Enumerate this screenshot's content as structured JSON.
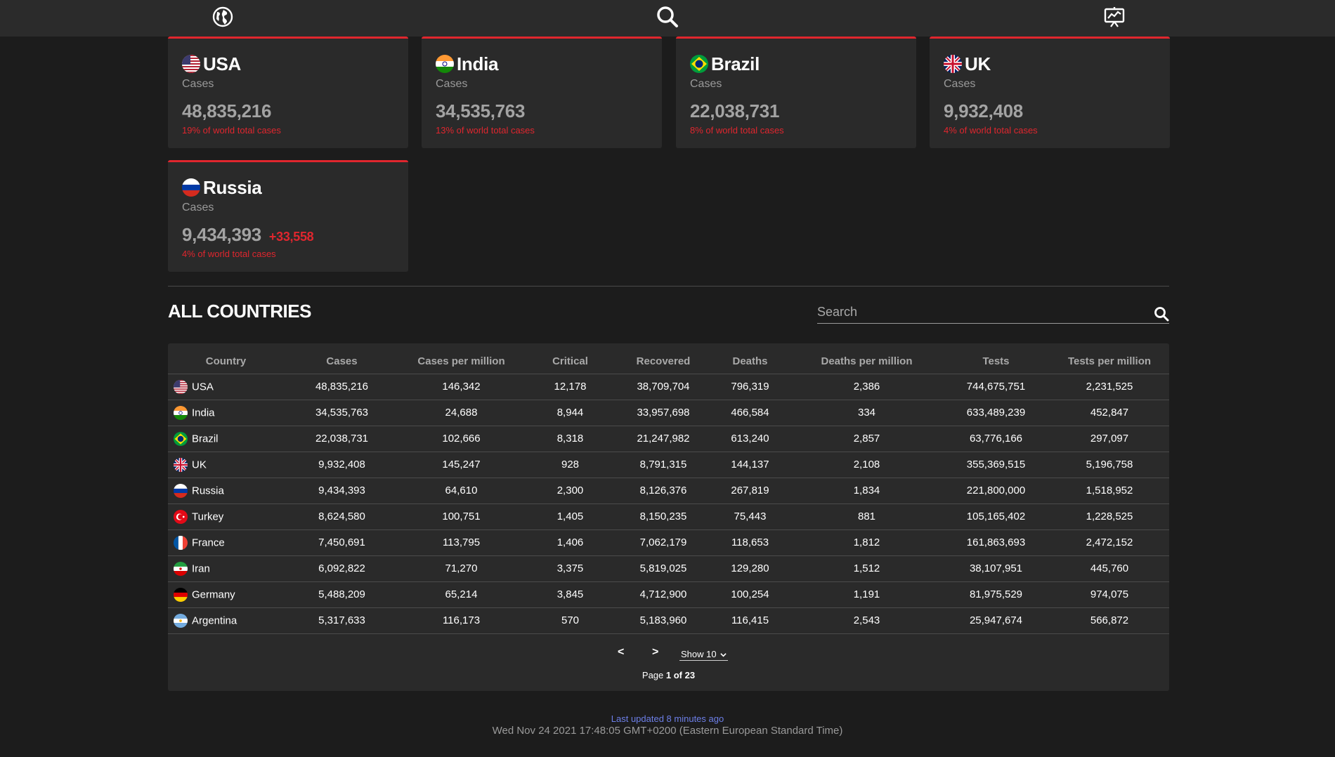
{
  "nav": {
    "icons": [
      "globe-icon",
      "search-icon",
      "presentation-chart-icon"
    ]
  },
  "cards": [
    {
      "name": "USA",
      "label": "Cases",
      "value": "48,835,216",
      "delta": "",
      "pct": "19% of world total cases",
      "flag": "usa"
    },
    {
      "name": "India",
      "label": "Cases",
      "value": "34,535,763",
      "delta": "",
      "pct": "13% of world total cases",
      "flag": "india"
    },
    {
      "name": "Brazil",
      "label": "Cases",
      "value": "22,038,731",
      "delta": "",
      "pct": "8% of world total cases",
      "flag": "brazil"
    },
    {
      "name": "UK",
      "label": "Cases",
      "value": "9,932,408",
      "delta": "",
      "pct": "4% of world total cases",
      "flag": "uk"
    },
    {
      "name": "Russia",
      "label": "Cases",
      "value": "9,434,393",
      "delta": "+33,558",
      "pct": "4% of world total cases",
      "flag": "russia"
    }
  ],
  "section": {
    "title": "ALL COUNTRIES",
    "search_placeholder": "Search"
  },
  "table": {
    "columns": [
      "Country",
      "Cases",
      "Cases per million",
      "Critical",
      "Recovered",
      "Deaths",
      "Deaths per million",
      "Tests",
      "Tests per million"
    ],
    "rows": [
      {
        "flag": "usa",
        "cells": [
          "USA",
          "48,835,216",
          "146,342",
          "12,178",
          "38,709,704",
          "796,319",
          "2,386",
          "744,675,751",
          "2,231,525"
        ]
      },
      {
        "flag": "india",
        "cells": [
          "India",
          "34,535,763",
          "24,688",
          "8,944",
          "33,957,698",
          "466,584",
          "334",
          "633,489,239",
          "452,847"
        ]
      },
      {
        "flag": "brazil",
        "cells": [
          "Brazil",
          "22,038,731",
          "102,666",
          "8,318",
          "21,247,982",
          "613,240",
          "2,857",
          "63,776,166",
          "297,097"
        ]
      },
      {
        "flag": "uk",
        "cells": [
          "UK",
          "9,932,408",
          "145,247",
          "928",
          "8,791,315",
          "144,137",
          "2,108",
          "355,369,515",
          "5,196,758"
        ]
      },
      {
        "flag": "russia",
        "cells": [
          "Russia",
          "9,434,393",
          "64,610",
          "2,300",
          "8,126,376",
          "267,819",
          "1,834",
          "221,800,000",
          "1,518,952"
        ]
      },
      {
        "flag": "turkey",
        "cells": [
          "Turkey",
          "8,624,580",
          "100,751",
          "1,405",
          "8,150,235",
          "75,443",
          "881",
          "105,165,402",
          "1,228,525"
        ]
      },
      {
        "flag": "france",
        "cells": [
          "France",
          "7,450,691",
          "113,795",
          "1,406",
          "7,062,179",
          "118,653",
          "1,812",
          "161,863,693",
          "2,472,152"
        ]
      },
      {
        "flag": "iran",
        "cells": [
          "Iran",
          "6,092,822",
          "71,270",
          "3,375",
          "5,819,025",
          "129,280",
          "1,512",
          "38,107,951",
          "445,760"
        ]
      },
      {
        "flag": "germany",
        "cells": [
          "Germany",
          "5,488,209",
          "65,214",
          "3,845",
          "4,712,900",
          "100,254",
          "1,191",
          "81,975,529",
          "974,075"
        ]
      },
      {
        "flag": "argentina",
        "cells": [
          "Argentina",
          "5,317,633",
          "116,173",
          "570",
          "5,183,960",
          "116,415",
          "2,543",
          "25,947,674",
          "566,872"
        ]
      }
    ]
  },
  "pager": {
    "prev": "<",
    "next": ">",
    "show_label": "Show 10",
    "page_prefix": "Page ",
    "page_current": "1 of 23"
  },
  "footer": {
    "updated": "Last updated 8 minutes ago",
    "timestamp": "Wed Nov 24 2021 17:48:05 GMT+0200 (Eastern European Standard Time)"
  },
  "colors": {
    "accent": "#e0262e",
    "link": "#6d7fe8",
    "panel": "#2a2a2a",
    "background": "#1c1c1c"
  }
}
